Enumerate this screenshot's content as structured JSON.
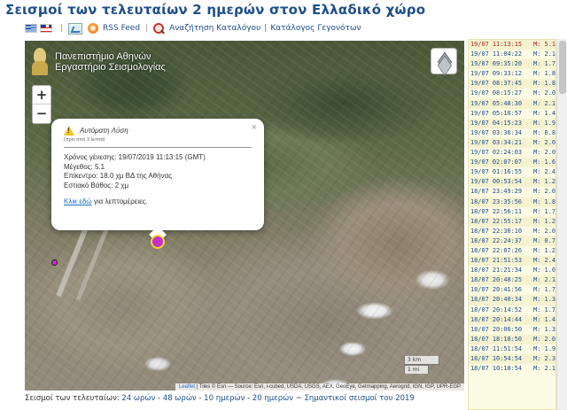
{
  "header": {
    "title": "Σεισμοί των τελευταίων 2 ημερών στον Ελλαδικό χώρο"
  },
  "toolbar": {
    "flags": [
      "greek-flag-icon",
      "uk-flag-icon"
    ],
    "rss": "RSS Feed",
    "search": "Αναζήτηση Καταλόγου",
    "catalog": "Κατάλογος Γεγονότων",
    "separator": "|"
  },
  "map": {
    "institution_line1": "Πανεπιστήμιο Αθηνών",
    "institution_line2": "Εργαστήριο Σεισμολογίας",
    "zoom_in": "+",
    "zoom_out": "−",
    "scale_km": "3 km",
    "scale_mi": "1 mi",
    "attribution_leaflet": "Leaflet",
    "attribution_text": " | Tiles © Esri — Source: Esri, i-cubed, USDA, USGS, AEX, GeoEye, Getmapping, Aerogrid, IGN, IGP, UPR-EGP",
    "popup": {
      "close": "×",
      "heading": "Αυτόματη Λύση",
      "subheading": "(πριν από 3 λεπτά)",
      "origin_time": "Χρόνος γένεσης: 19/07/2019 11:13:15 (GMT)",
      "magnitude": "Μέγεθος: 5.1",
      "epicenter": "Επίκεντρο: 18.0 χμ ΒΔ της Αθήνας",
      "depth": "Εστιακό Βάθος: 2 χμ",
      "link": "Κλικ εδώ",
      "link_suffix": " για λεπτομέρειες."
    }
  },
  "events": [
    {
      "dt": "19/07 11:13:15",
      "mag": "M: 5.1"
    },
    {
      "dt": "19/07 11:04:22",
      "mag": "M: 2.1"
    },
    {
      "dt": "19/07 09:35:20",
      "mag": "M: 1.7"
    },
    {
      "dt": "19/07 09:33:12",
      "mag": "M: 1.8"
    },
    {
      "dt": "19/07 08:37:45",
      "mag": "M: 1.8"
    },
    {
      "dt": "19/07 08:15:27",
      "mag": "M: 2.0"
    },
    {
      "dt": "19/07 05:48:30",
      "mag": "M: 2.1"
    },
    {
      "dt": "19/07 05:10:57",
      "mag": "M: 1.4"
    },
    {
      "dt": "19/07 04:15:23",
      "mag": "M: 1.9"
    },
    {
      "dt": "19/07 03:36:34",
      "mag": "M: 0.8"
    },
    {
      "dt": "19/07 03:34:21",
      "mag": "M: 2.0"
    },
    {
      "dt": "19/07 02:24:03",
      "mag": "M: 2.0"
    },
    {
      "dt": "19/07 02:07:07",
      "mag": "M: 1.6"
    },
    {
      "dt": "19/07 01:16:55",
      "mag": "M: 2.4"
    },
    {
      "dt": "19/07 00:53:54",
      "mag": "M: 1.2"
    },
    {
      "dt": "18/07 23:49:29",
      "mag": "M: 2.0"
    },
    {
      "dt": "18/07 23:35:56",
      "mag": "M: 1.8"
    },
    {
      "dt": "18/07 22:56:11",
      "mag": "M: 1.7"
    },
    {
      "dt": "18/07 22:55:17",
      "mag": "M: 1.2"
    },
    {
      "dt": "18/07 22:30:10",
      "mag": "M: 2.0"
    },
    {
      "dt": "18/07 22:24:37",
      "mag": "M: 0.7"
    },
    {
      "dt": "18/07 22:07:26",
      "mag": "M: 1.2"
    },
    {
      "dt": "18/07 21:51:53",
      "mag": "M: 2.4"
    },
    {
      "dt": "18/07 21:21:34",
      "mag": "M: 1.0"
    },
    {
      "dt": "18/07 20:48:25",
      "mag": "M: 2.1"
    },
    {
      "dt": "18/07 20:41:56",
      "mag": "M: 1.7"
    },
    {
      "dt": "18/07 20:40:34",
      "mag": "M: 1.3"
    },
    {
      "dt": "18/07 20:14:52",
      "mag": "M: 1.7"
    },
    {
      "dt": "18/07 20:14:44",
      "mag": "M: 1.4"
    },
    {
      "dt": "18/07 20:06:50",
      "mag": "M: 1.3"
    },
    {
      "dt": "18/07 18:18:50",
      "mag": "M: 2.0"
    },
    {
      "dt": "18/07 11:51:54",
      "mag": "M: 1.9"
    },
    {
      "dt": "18/07 10:54:54",
      "mag": "M: 2.3"
    },
    {
      "dt": "18/07 10:18:54",
      "mag": "M: 2.1"
    }
  ],
  "footer": {
    "label": "Σεισμοί των τελευταίων: ",
    "h24": "24 ωρών",
    "h48": "48 ωρών",
    "d10": "10 ημερών",
    "d20": "20 ημερών",
    "significant": "Σημαντικοί σεισμοί του 2019"
  },
  "colors": {
    "title": "#1f4e8c",
    "marker": "#c72fd0",
    "marker_ring": "#f5d335",
    "panel_bg": "#fcfbe3"
  }
}
